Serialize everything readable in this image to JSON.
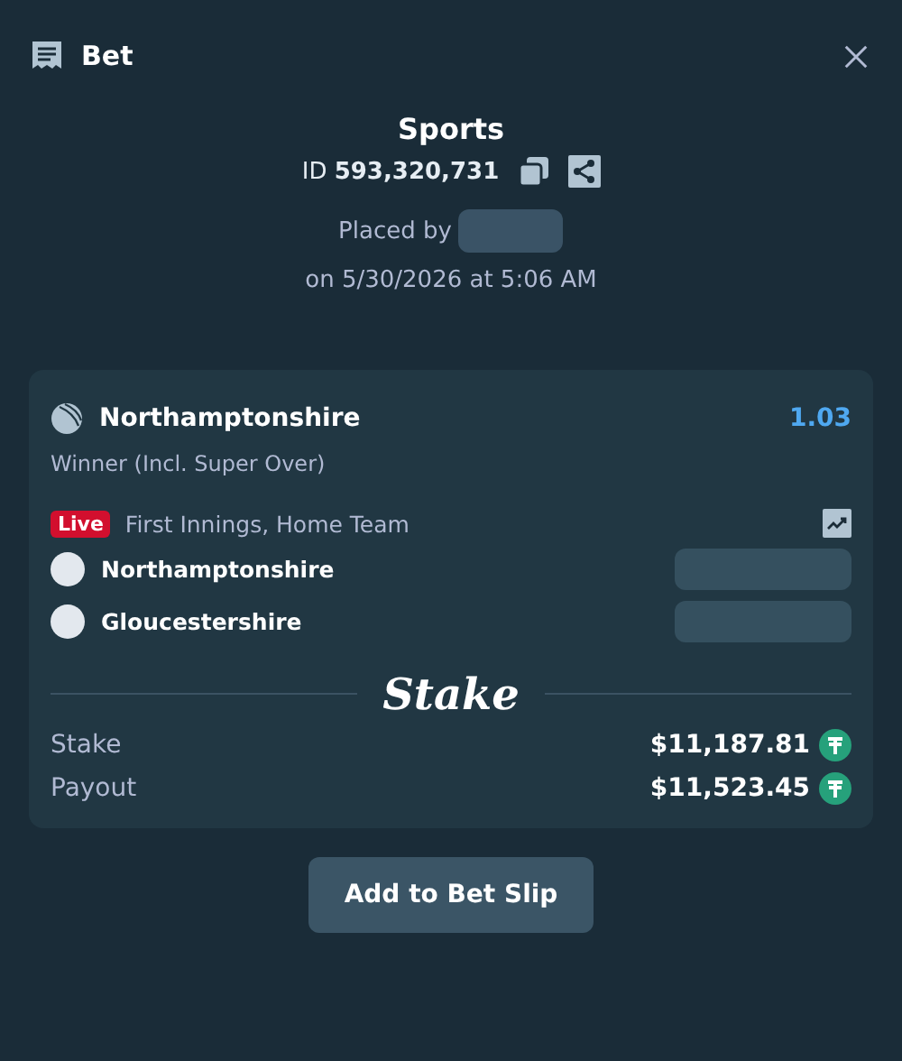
{
  "header": {
    "title": "Bet"
  },
  "summary": {
    "category": "Sports",
    "bet_id": "ID **593,320,731**",
    "placed_by": "Placed by",
    "date": "on 5/30/2026 at 5:06 AM"
  },
  "selection": {
    "team": "Northamptonshire",
    "odds": "1.03",
    "market": "Winner (Incl. Super Over)",
    "live_badge": "Live",
    "live": true,
    "event": "First Innings, Home Team",
    "teams": [
      {
        "name": "Northamptonshire"
      },
      {
        "name": "Gloucestershire"
      }
    ]
  },
  "brand": "Stake",
  "amounts": [
    {
      "label": "Stake",
      "value": "$11,187.81"
    },
    {
      "label": "Payout",
      "value": "$11,523.45"
    }
  ],
  "button": "Add to Bet Slip"
}
